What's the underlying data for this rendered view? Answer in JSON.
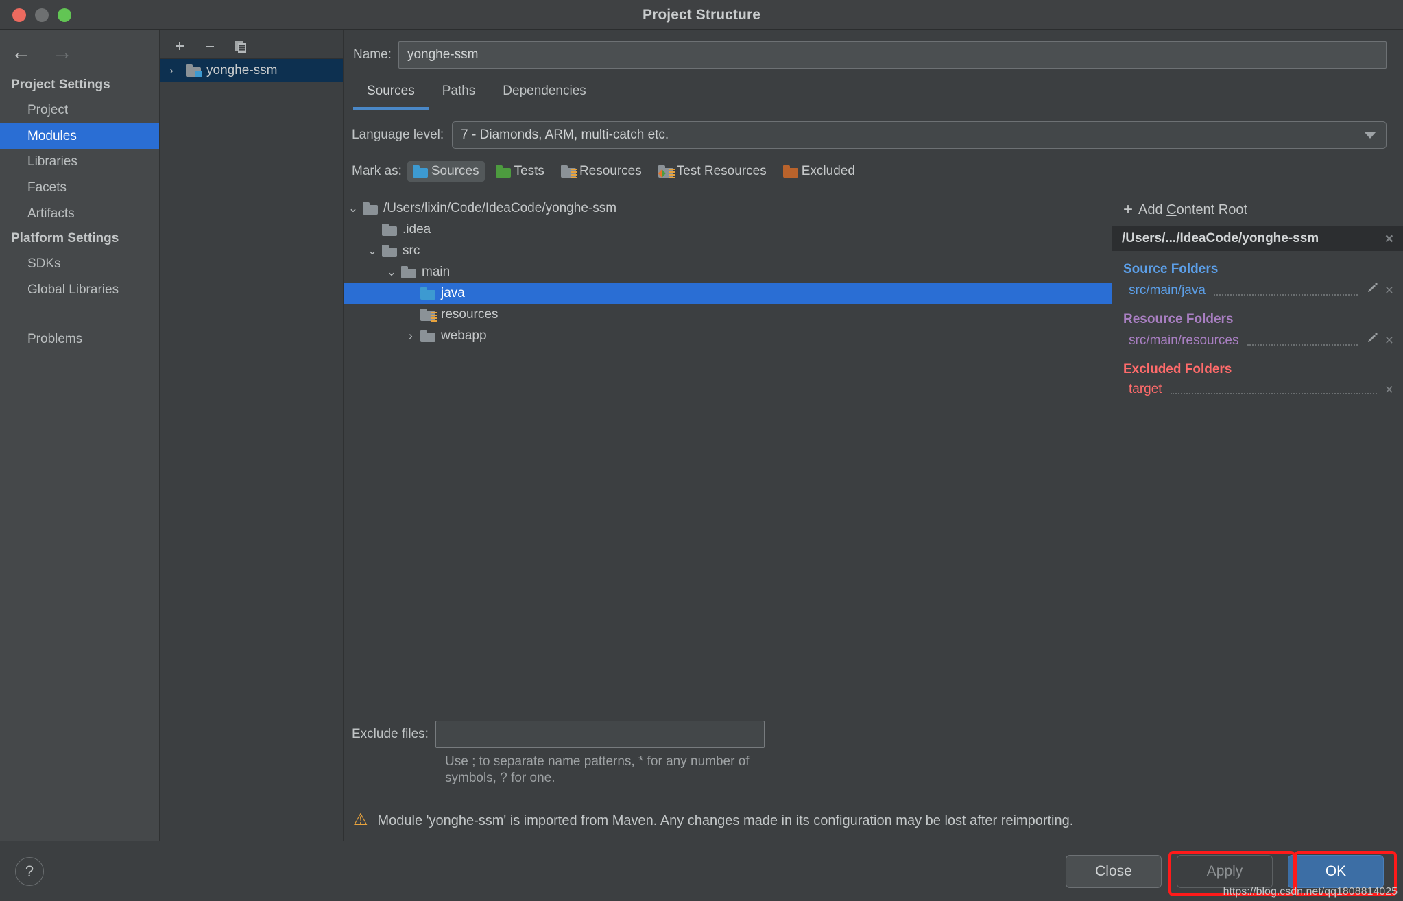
{
  "window": {
    "title": "Project Structure",
    "traffic_lights": [
      "close-red",
      "minimize-grey",
      "maximize-green"
    ]
  },
  "sidebar": {
    "nav": {
      "back": "←",
      "forward": "→"
    },
    "groups": [
      {
        "title": "Project Settings",
        "items": [
          {
            "label": "Project",
            "selected": false
          },
          {
            "label": "Modules",
            "selected": true
          },
          {
            "label": "Libraries",
            "selected": false
          },
          {
            "label": "Facets",
            "selected": false
          },
          {
            "label": "Artifacts",
            "selected": false
          }
        ]
      },
      {
        "title": "Platform Settings",
        "items": [
          {
            "label": "SDKs",
            "selected": false
          },
          {
            "label": "Global Libraries",
            "selected": false
          }
        ]
      }
    ],
    "problems": {
      "label": "Problems"
    }
  },
  "modules_panel": {
    "toolbar": {
      "add": "+",
      "remove": "−",
      "copy": "copy-icon"
    },
    "items": [
      {
        "label": "yonghe-ssm",
        "selected": true,
        "expand": "›"
      }
    ]
  },
  "main": {
    "name": {
      "label": "Name:",
      "value": "yonghe-ssm",
      "placeholder": ""
    },
    "tabs": [
      {
        "label": "Sources",
        "active": true
      },
      {
        "label": "Paths",
        "active": false
      },
      {
        "label": "Dependencies",
        "active": false
      }
    ],
    "language_level": {
      "label": "Language level:",
      "value": "7 - Diamonds, ARM, multi-catch etc."
    },
    "mark_as": {
      "label": "Mark as:",
      "buttons": [
        {
          "label": "Sources",
          "mnemonic": "S",
          "icon": "folder-blue",
          "active": true
        },
        {
          "label": "Tests",
          "mnemonic": "T",
          "icon": "folder-green",
          "active": false
        },
        {
          "label": "Resources",
          "mnemonic": "R",
          "icon": "folder-grey-lines",
          "active": false
        },
        {
          "label": "Test Resources",
          "mnemonic": "",
          "icon": "folder-grey-diamond-lines",
          "active": false
        },
        {
          "label": "Excluded",
          "mnemonic": "E",
          "icon": "folder-orange",
          "active": false
        }
      ]
    },
    "tree": [
      {
        "label": "/Users/lixin/Code/IdeaCode/yonghe-ssm",
        "depth": 0,
        "chevron": "⌄",
        "icon": "folder-grey",
        "selected": false
      },
      {
        "label": ".idea",
        "depth": 2,
        "chevron": "",
        "icon": "folder-grey",
        "selected": false
      },
      {
        "label": "src",
        "depth": 1,
        "chevron": "⌄",
        "icon": "folder-grey",
        "selected": false
      },
      {
        "label": "main",
        "depth": 2,
        "chevron": "⌄",
        "icon": "folder-grey",
        "selected": false
      },
      {
        "label": "java",
        "depth": 4,
        "chevron": "",
        "icon": "folder-blue",
        "selected": true
      },
      {
        "label": "resources",
        "depth": 4,
        "chevron": "",
        "icon": "folder-grey-lines",
        "selected": false
      },
      {
        "label": "webapp",
        "depth": 3,
        "chevron": "›",
        "icon": "folder-grey",
        "selected": false
      }
    ],
    "exclude_files": {
      "label": "Exclude files:",
      "value": "",
      "hint": "Use ; to separate name patterns, * for any number of symbols, ? for one."
    }
  },
  "info_pane": {
    "add_content_root": {
      "label": "Add Content Root",
      "plus": "+"
    },
    "content_root": {
      "path": "/Users/.../IdeaCode/yonghe-ssm",
      "close": "×"
    },
    "sections": [
      {
        "title": "Source Folders",
        "kind": "src",
        "color": "#5c9fe8",
        "entries": [
          {
            "path": "src/main/java",
            "edit": true,
            "remove": true
          }
        ]
      },
      {
        "title": "Resource Folders",
        "kind": "res",
        "color": "#a97fc2",
        "entries": [
          {
            "path": "src/main/resources",
            "edit": true,
            "remove": true
          }
        ]
      },
      {
        "title": "Excluded Folders",
        "kind": "exc",
        "color": "#ff6b6b",
        "entries": [
          {
            "path": "target",
            "edit": false,
            "remove": true
          }
        ]
      }
    ]
  },
  "warning": {
    "icon": "warning-triangle-icon",
    "text": "Module 'yonghe-ssm' is imported from Maven. Any changes made in its configuration may be lost after reimporting."
  },
  "footer": {
    "help": "?",
    "buttons": [
      {
        "label": "Close",
        "kind": "close",
        "annotated": false
      },
      {
        "label": "Apply",
        "kind": "apply",
        "annotated": true
      },
      {
        "label": "OK",
        "kind": "ok",
        "annotated": true
      }
    ],
    "watermark": "https://blog.csdn.net/qq1808814025"
  },
  "colors": {
    "accent_blue": "#2a6ed4",
    "tab_underline": "#4a88c7",
    "source_blue": "#5c9fe8",
    "resource_purple": "#a97fc2",
    "excluded_red": "#ff6b6b",
    "annotation_red": "#ff1a1a",
    "warning_amber": "#e8a33d"
  }
}
